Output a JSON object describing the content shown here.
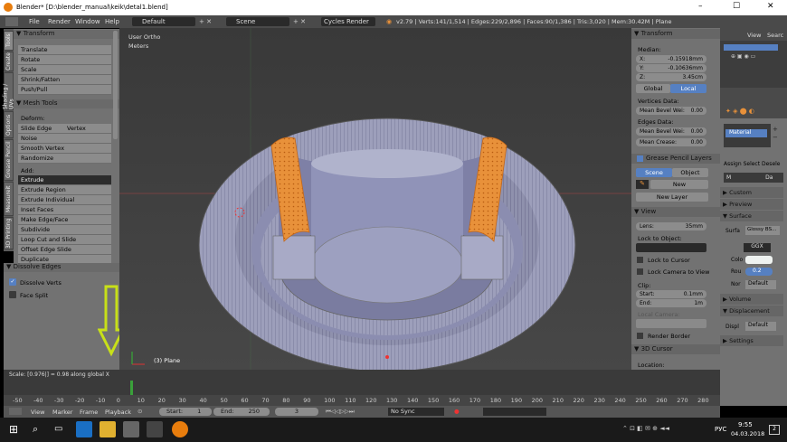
{
  "window": {
    "title": "Blender* [D:\\blender_manual\\keik\\detal1.blend]",
    "minimize": "–",
    "maximize": "☐",
    "close": "✕"
  },
  "topbar": {
    "menus": [
      "File",
      "Render",
      "Window",
      "Help"
    ],
    "layout": "Default",
    "scene": "Scene",
    "engine": "Cycles Render",
    "stats": "v2.79 | Verts:141/1,514 | Edges:229/2,896 | Faces:90/1,386 | Tris:3,020 | Mem:30.42M | Plane"
  },
  "left_tabs": [
    "Tools",
    "Create",
    "Shading / UVs",
    "Options",
    "Grease Pencil",
    "Measureit",
    "3D Printing"
  ],
  "transform_panel": {
    "header": "▼ Transform",
    "tools": [
      "Translate",
      "Rotate",
      "Scale",
      "Shrink/Fatten",
      "Push/Pull"
    ]
  },
  "mesh_tools_panel": {
    "header": "▼ Mesh Tools",
    "deform_label": "Deform:",
    "slide_edge": "Slide Edge",
    "vertex": "Vertex",
    "deform_tools": [
      "Noise",
      "Smooth Vertex",
      "Randomize"
    ],
    "add_label": "Add:",
    "extrude": "Extrude",
    "add_tools": [
      "Extrude Region",
      "Extrude Individual",
      "Inset Faces",
      "Make Edge/Face",
      "Subdivide",
      "Loop Cut and Slide",
      "Offset Edge Slide",
      "Duplicate"
    ]
  },
  "operator_panel": {
    "header": "▼ Dissolve Edges",
    "dissolve_verts": "Dissolve Verts",
    "dissolve_verts_checked": true,
    "face_split": "Face Split",
    "face_split_checked": false
  },
  "viewport": {
    "view_name": "User Ortho",
    "units": "Meters",
    "object_label": "(3) Plane",
    "status": "Scale: [0.976|] = 0.98 along global X"
  },
  "n_panel": {
    "transform_header": "▼ Transform",
    "median_label": "Median:",
    "x": "X:",
    "x_val": "-0.15918mm",
    "y": "Y:",
    "y_val": "-0.10636mm",
    "z": "Z:",
    "z_val": "3.45cm",
    "global": "Global",
    "local": "Local",
    "vertices_data": "Vertices Data:",
    "mean_bevel_1": "Mean Bevel Wei:",
    "mean_bevel_1_val": "0.00",
    "edges_data": "Edges Data:",
    "mean_bevel_2": "Mean Bevel Wei:",
    "mean_bevel_2_val": "0.00",
    "mean_crease": "Mean Crease:",
    "mean_crease_val": "0.00",
    "gp_header": "Grease Pencil Layers",
    "gp_scene": "Scene",
    "gp_object": "Object",
    "gp_new": "New",
    "gp_new_layer": "New Layer",
    "view_header": "▼ View",
    "lens": "Lens:",
    "lens_val": "35mm",
    "lock_to_object": "Lock to Object:",
    "lock_to_cursor": "Lock to Cursor",
    "lock_camera": "Lock Camera to View",
    "clip": "Clip:",
    "clip_start": "Start:",
    "clip_start_val": "0.1mm",
    "clip_end": "End:",
    "clip_end_val": "1m",
    "local_camera": "Local Camera:",
    "render_border": "Render Border",
    "cursor_header": "▼ 3D Cursor",
    "location": "Location:"
  },
  "right_column": {
    "view": "View",
    "search": "Searc",
    "material": "Material",
    "assign": "Assign",
    "select": "Select",
    "deselect": "Desele",
    "mat_short": "M",
    "data_short": "Da",
    "custom_props": "▶ Custom PropertFes",
    "preview": "▶ Preview",
    "surface_header": "▼ Surface",
    "surface_label": "Surfa",
    "surface_val": "Glossy BS...",
    "ggx": "GGX",
    "color_label": "Colo",
    "rough_label": "Rou",
    "rough_val": "0.2",
    "normal_label": "Nor",
    "normal_val": "Default",
    "volume": "▶ Volume",
    "displacement": "▼ Displacement",
    "displ_label": "Displ",
    "displ_val": "Default",
    "settings": "▶ Settings"
  },
  "timeline": {
    "ticks": [
      "-50",
      "-40",
      "-30",
      "-20",
      "-10",
      "0",
      "10",
      "20",
      "30",
      "40",
      "50",
      "60",
      "70",
      "80",
      "90",
      "100",
      "110",
      "120",
      "130",
      "140",
      "150",
      "160",
      "170",
      "180",
      "190",
      "200",
      "210",
      "220",
      "230",
      "240",
      "250",
      "260",
      "270",
      "280"
    ],
    "current_frame": 0
  },
  "timeline_bar": {
    "view": "View",
    "marker": "Marker",
    "frame": "Frame",
    "playback": "Playback",
    "start_label": "Start:",
    "start_val": "1",
    "end_label": "End:",
    "end_val": "250",
    "current": "3",
    "sync": "No Sync"
  },
  "taskbar": {
    "time": "9:55",
    "date": "04.03.2018",
    "lang": "РУС",
    "notif": "2"
  },
  "colors": {
    "accent": "#5680c2",
    "orange": "#e8913a",
    "arrow": "#c8e018"
  }
}
